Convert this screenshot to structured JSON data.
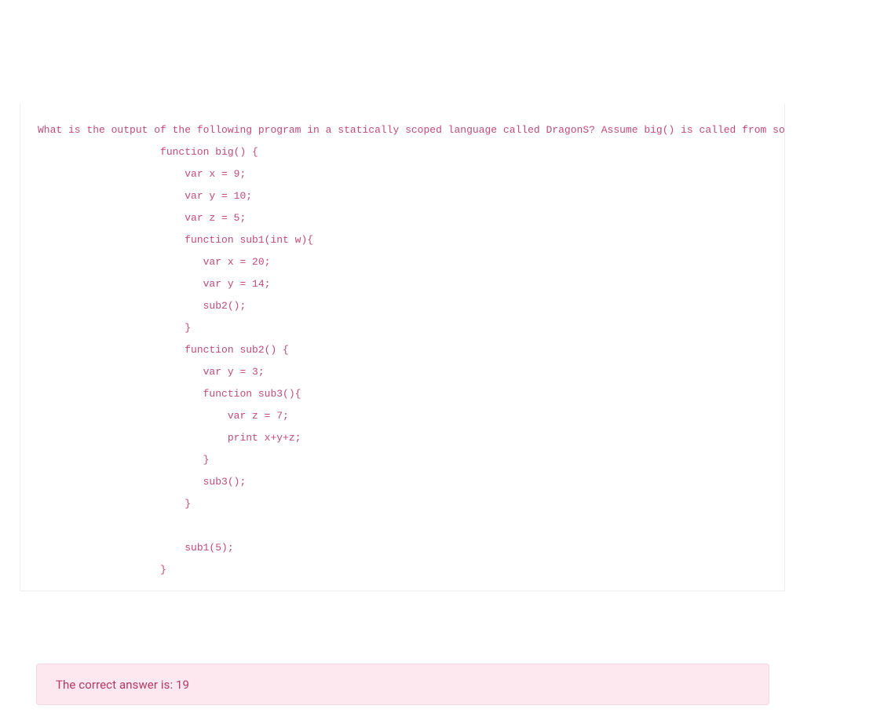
{
  "question": {
    "prompt_line": "What is the output of the following program in a statically scoped language called DragonS? Assume big() is called from somewhere.",
    "code_lines": [
      "                    function big() {",
      "                        var x = 9;",
      "                        var y = 10;",
      "                        var z = 5;",
      "                        function sub1(int w){",
      "                           var x = 20;",
      "                           var y = 14;",
      "                           sub2();",
      "                        }",
      "                        function sub2() {",
      "                           var y = 3;",
      "                           function sub3(){",
      "                               var z = 7;",
      "                               print x+y+z;",
      "                           }",
      "                           sub3();",
      "                        }",
      "",
      "                        sub1(5);",
      "                    }"
    ]
  },
  "answer": {
    "label": "The correct answer is: 19"
  }
}
